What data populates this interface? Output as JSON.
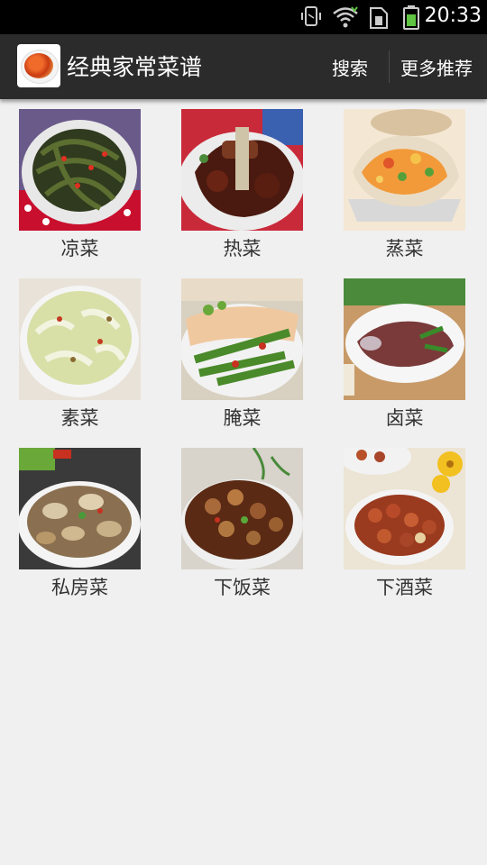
{
  "status_bar": {
    "time": "20:33",
    "icons": [
      "vibrate-icon",
      "wifi-icon",
      "sim-icon",
      "battery-icon"
    ]
  },
  "action_bar": {
    "title": "经典家常菜谱",
    "search_label": "搜索",
    "more_label": "更多推荐",
    "app_icon": "dish-icon"
  },
  "categories": [
    {
      "label": "凉菜",
      "image": "kelp-salad-photo"
    },
    {
      "label": "热菜",
      "image": "braised-ribs-photo"
    },
    {
      "label": "蒸菜",
      "image": "steamed-scallop-photo"
    },
    {
      "label": "素菜",
      "image": "stir-fried-cabbage-photo"
    },
    {
      "label": "腌菜",
      "image": "pickled-vegetables-photo"
    },
    {
      "label": "卤菜",
      "image": "braised-duck-photo"
    },
    {
      "label": "私房菜",
      "image": "clams-photo"
    },
    {
      "label": "下饭菜",
      "image": "stir-fried-meat-photo"
    },
    {
      "label": "下酒菜",
      "image": "fried-peanuts-photo"
    }
  ],
  "colors": {
    "status_bar": "#000000",
    "action_bar": "#2b2b2b",
    "background": "#f0f0f0",
    "label_text": "#333333"
  }
}
